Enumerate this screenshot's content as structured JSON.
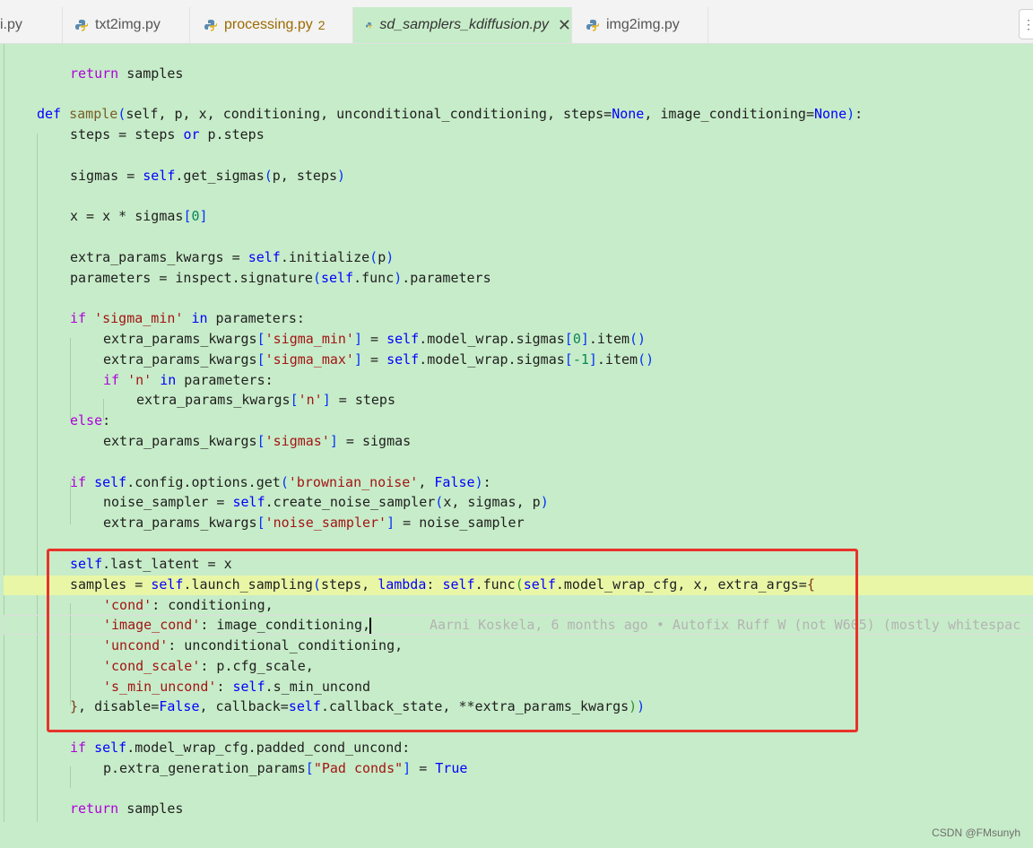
{
  "tabs": [
    {
      "label": "i.py",
      "active": false
    },
    {
      "label": "txt2img.py",
      "active": false
    },
    {
      "label": "processing.py",
      "badge": "2",
      "active": false,
      "modified": true
    },
    {
      "label": "sd_samplers_kdiffusion.py",
      "active": true,
      "close": "✕"
    },
    {
      "label": "img2img.py",
      "active": false
    }
  ],
  "more_menu": "⋮",
  "blame": "Aarni Koskela, 6 months ago • Autofix Ruff W (not W605) (mostly whitespac",
  "watermark": "CSDN @FMsunyh",
  "colors": {
    "editor_background": "#c7ecc9",
    "highlight_line": "#e8f6a6",
    "annotation_box": "#e8322b"
  },
  "code": {
    "l01_return": "return",
    "l01_samples": " samples",
    "l02_def": "def",
    "l02_name": "sample",
    "l02_args1": "self, p, x, conditioning, unconditional_conditioning, steps=",
    "l02_none1": "None",
    "l02_args2": ", image_conditioning=",
    "l02_none2": "None",
    "l03_a": "steps = steps ",
    "l03_or": "or",
    "l03_b": " p.steps",
    "l04_a": "sigmas = ",
    "l04_self": "self",
    "l04_b": ".get_sigmas",
    "l04_args": "p, steps",
    "l05_a": "x = x * sigmas",
    "l05_idx": "0",
    "l06_a": "extra_params_kwargs = ",
    "l06_self": "self",
    "l06_b": ".initialize",
    "l06_arg": "p",
    "l07_a": "parameters = inspect.signature",
    "l07_self": "self",
    "l07_b": ".func",
    "l07_c": ".parameters",
    "l08_if": "if",
    "l08_str": "'sigma_min'",
    "l08_in": "in",
    "l08_b": " parameters:",
    "l09_a": "extra_params_kwargs",
    "l09_str": "'sigma_min'",
    "l09_b": " = ",
    "l09_self": "self",
    "l09_c": ".model_wrap.sigmas",
    "l09_idx": "0",
    "l09_d": ".item",
    "l10_a": "extra_params_kwargs",
    "l10_str": "'sigma_max'",
    "l10_b": " = ",
    "l10_self": "self",
    "l10_c": ".model_wrap.sigmas",
    "l10_idx": "-1",
    "l10_d": ".item",
    "l11_if": "if",
    "l11_str": "'n'",
    "l11_in": "in",
    "l11_b": " parameters:",
    "l12_a": "extra_params_kwargs",
    "l12_str": "'n'",
    "l12_b": " = steps",
    "l13_else": "else",
    "l14_a": "extra_params_kwargs",
    "l14_str": "'sigmas'",
    "l14_b": " = sigmas",
    "l15_if": "if",
    "l15_self": "self",
    "l15_b": ".config.options.get",
    "l15_str": "'brownian_noise'",
    "l15_false": "False",
    "l16_a": "noise_sampler = ",
    "l16_self": "self",
    "l16_b": ".create_noise_sampler",
    "l16_args": "x, sigmas, p",
    "l17_a": "extra_params_kwargs",
    "l17_str": "'noise_sampler'",
    "l17_b": " = noise_sampler",
    "l18_self": "self",
    "l18_b": ".last_latent = x",
    "l19_a": "samples = ",
    "l19_self": "self",
    "l19_b": ".launch_sampling",
    "l19_c": "steps, ",
    "l19_lambda": "lambda",
    "l19_d": ": ",
    "l19_self2": "self",
    "l19_e": ".func",
    "l19_self3": "self",
    "l19_f": ".model_wrap_cfg, x, extra_args=",
    "l20_str": "'cond'",
    "l20_b": ": conditioning,",
    "l21_str": "'image_cond'",
    "l21_b": ": image_conditioning,",
    "l22_str": "'uncond'",
    "l22_b": ": unconditional_conditioning,",
    "l23_str": "'cond_scale'",
    "l23_b": ": p.cfg_scale,",
    "l24_str": "'s_min_uncond'",
    "l24_b": ": ",
    "l24_self": "self",
    "l24_c": ".s_min_uncond",
    "l25_a": ", disable=",
    "l25_false": "False",
    "l25_b": ", callback=",
    "l25_self": "self",
    "l25_c": ".callback_state, **extra_params_kwargs",
    "l26_if": "if",
    "l26_self": "self",
    "l26_b": ".model_wrap_cfg.padded_cond_uncond:",
    "l27_a": "p.extra_generation_params",
    "l27_str": "\"Pad conds\"",
    "l27_b": " = ",
    "l27_true": "True",
    "l28_return": "return",
    "l28_b": " samples"
  }
}
